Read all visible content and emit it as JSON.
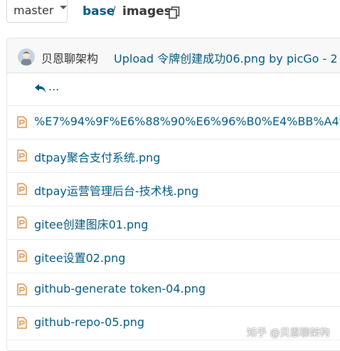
{
  "branch": {
    "label": "master"
  },
  "breadcrumb": {
    "repo": "base",
    "separator": "/",
    "current": "images"
  },
  "commit": {
    "author": "贝恩聊架构",
    "message": "Upload 令牌创建成功06.png by picGo - 2"
  },
  "parent_link": {
    "label": "..."
  },
  "files": [
    {
      "name": "%E7%94%9F%E6%88%90%E6%96%B0%E4%BB%A4%..."
    },
    {
      "name": "dtpay聚合支付系统.png"
    },
    {
      "name": "dtpay运营管理后台-技术栈.png"
    },
    {
      "name": "gitee创建图床01.png"
    },
    {
      "name": "gitee设置02.png"
    },
    {
      "name": "github-generate token-04.png"
    },
    {
      "name": "github-repo-05.png"
    }
  ],
  "watermark": {
    "text": "知乎 @贝恩聊架构"
  },
  "colors": {
    "link": "#005980",
    "file_icon": "#e0904a",
    "border": "#e3e3e3"
  }
}
